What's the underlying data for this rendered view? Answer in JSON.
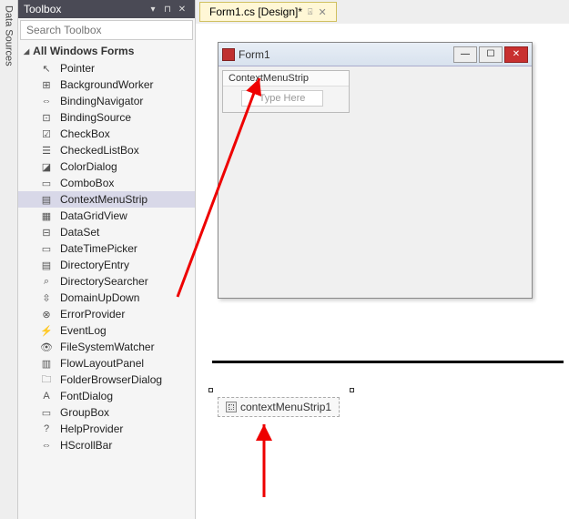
{
  "vtab": {
    "label": "Data Sources"
  },
  "toolbox": {
    "title": "Toolbox",
    "search_placeholder": "Search Toolbox",
    "group_label": "All Windows Forms",
    "items": [
      {
        "icon": "↖",
        "label": "Pointer"
      },
      {
        "icon": "⊞",
        "label": "BackgroundWorker"
      },
      {
        "icon": "⇔",
        "label": "BindingNavigator"
      },
      {
        "icon": "⊡",
        "label": "BindingSource"
      },
      {
        "icon": "☑",
        "label": "CheckBox"
      },
      {
        "icon": "☰",
        "label": "CheckedListBox"
      },
      {
        "icon": "◪",
        "label": "ColorDialog"
      },
      {
        "icon": "▭",
        "label": "ComboBox"
      },
      {
        "icon": "▤",
        "label": "ContextMenuStrip",
        "selected": true
      },
      {
        "icon": "▦",
        "label": "DataGridView"
      },
      {
        "icon": "⊟",
        "label": "DataSet"
      },
      {
        "icon": "▭",
        "label": "DateTimePicker"
      },
      {
        "icon": "▤",
        "label": "DirectoryEntry"
      },
      {
        "icon": "⌕",
        "label": "DirectorySearcher"
      },
      {
        "icon": "⇳",
        "label": "DomainUpDown"
      },
      {
        "icon": "⊗",
        "label": "ErrorProvider"
      },
      {
        "icon": "⚡",
        "label": "EventLog"
      },
      {
        "icon": "👁",
        "label": "FileSystemWatcher"
      },
      {
        "icon": "▥",
        "label": "FlowLayoutPanel"
      },
      {
        "icon": "🗀",
        "label": "FolderBrowserDialog"
      },
      {
        "icon": "A",
        "label": "FontDialog"
      },
      {
        "icon": "▭",
        "label": "GroupBox"
      },
      {
        "icon": "?",
        "label": "HelpProvider"
      },
      {
        "icon": "⇔",
        "label": "HScrollBar"
      }
    ]
  },
  "document_tab": {
    "label": "Form1.cs [Design]*"
  },
  "form": {
    "title": "Form1",
    "cms_label": "ContextMenuStrip",
    "type_here": "Type Here"
  },
  "tray": {
    "item_label": "contextMenuStrip1"
  }
}
